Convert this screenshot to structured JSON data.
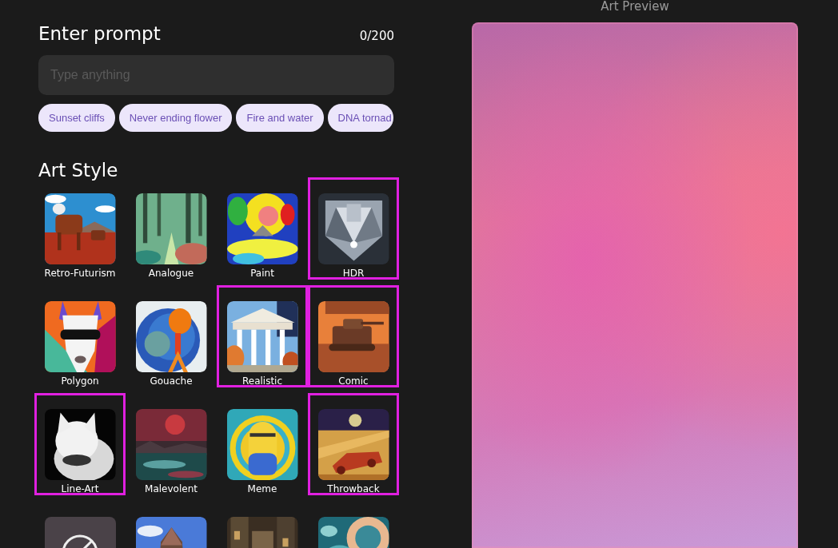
{
  "prompt": {
    "title": "Enter prompt",
    "counter": "0/200",
    "placeholder": "Type anything"
  },
  "suggestions": [
    {
      "label": "Sunset cliffs"
    },
    {
      "label": "Never ending flower"
    },
    {
      "label": "Fire and water"
    },
    {
      "label": "DNA tornad"
    }
  ],
  "art_style": {
    "title": "Art Style",
    "styles": [
      {
        "kind": "picture",
        "label": "Retro-Futurism",
        "selected": false
      },
      {
        "kind": "picture",
        "label": "Analogue",
        "selected": false
      },
      {
        "kind": "picture",
        "label": "Paint",
        "selected": false
      },
      {
        "kind": "picture",
        "label": "HDR",
        "selected": true
      },
      {
        "kind": "picture",
        "label": "Polygon",
        "selected": false
      },
      {
        "kind": "picture",
        "label": "Gouache",
        "selected": false
      },
      {
        "kind": "picture",
        "label": "Realistic",
        "selected": true
      },
      {
        "kind": "picture",
        "label": "Comic",
        "selected": true
      },
      {
        "kind": "picture",
        "label": "Line-Art",
        "selected": true
      },
      {
        "kind": "picture",
        "label": "Malevolent",
        "selected": false
      },
      {
        "kind": "picture",
        "label": "Meme",
        "selected": false
      },
      {
        "kind": "picture",
        "label": "Throwback",
        "selected": true
      },
      {
        "kind": "none",
        "selected": false
      },
      {
        "kind": "picture",
        "selected": false
      },
      {
        "kind": "picture",
        "selected": false
      },
      {
        "kind": "picture",
        "selected": false
      }
    ]
  },
  "preview": {
    "title": "Art Preview"
  }
}
